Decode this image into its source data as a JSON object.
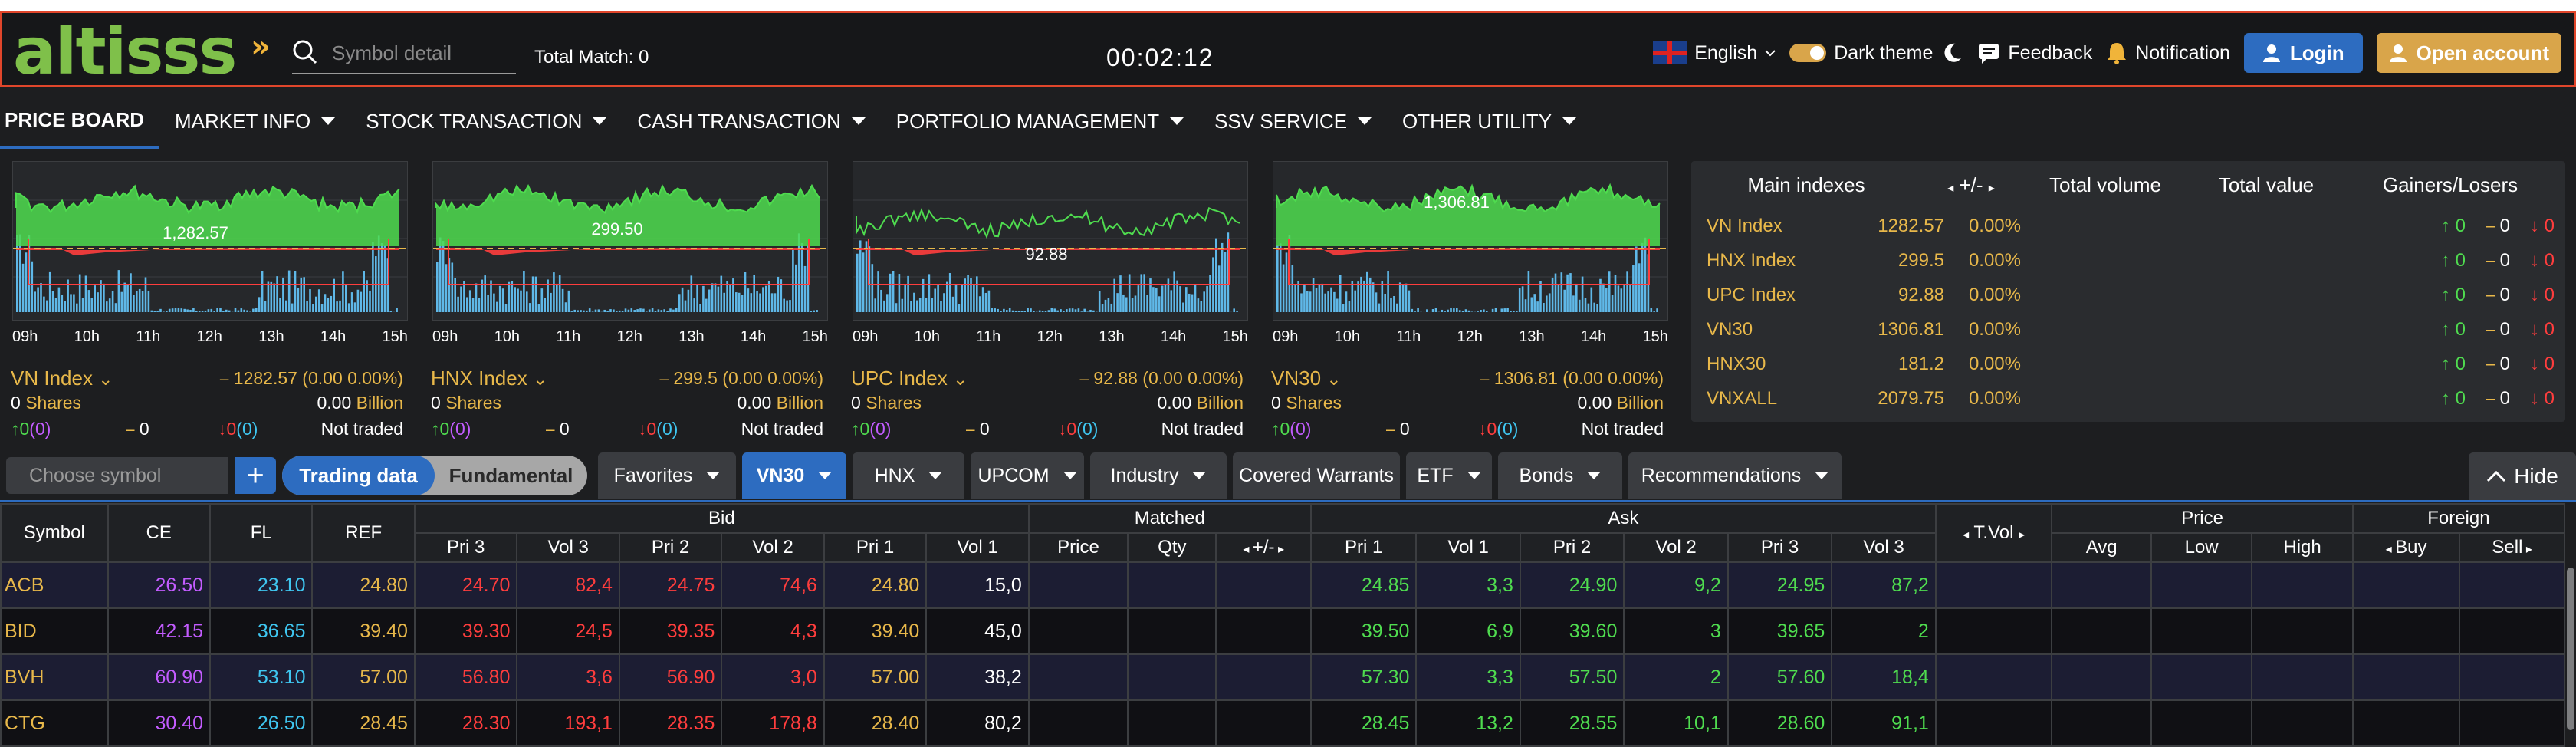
{
  "app": {
    "logo": "altisss",
    "logo_mark": "»"
  },
  "header": {
    "search_placeholder": "Symbol detail",
    "total_match": "Total Match: 0",
    "clock": "00:02:12",
    "language": "English",
    "dark_theme": "Dark theme",
    "feedback": "Feedback",
    "notification": "Notification",
    "login": "Login",
    "open_account": "Open account"
  },
  "nav": [
    "PRICE BOARD",
    "MARKET INFO",
    "STOCK TRANSACTION",
    "CASH TRANSACTION",
    "PORTFOLIO MANAGEMENT",
    "SSV SERVICE",
    "OTHER UTILITY"
  ],
  "hours": [
    "09h",
    "10h",
    "11h",
    "12h",
    "13h",
    "14h",
    "15h"
  ],
  "chart_data": [
    {
      "type": "area",
      "title": "VN Index",
      "label": "1,282.57"
    },
    {
      "type": "area",
      "title": "HNX Index",
      "label": "299.50"
    },
    {
      "type": "area",
      "title": "UPC Index",
      "label": "92.88"
    },
    {
      "type": "area",
      "title": "VN30",
      "label": "1,306.81"
    }
  ],
  "index_cards": [
    {
      "name": "VN Index",
      "value": "1282.57 (0.00 0.00%)",
      "shares": "0",
      "shares_label": "Shares",
      "billion": "0.00",
      "billion_label": "Billion",
      "up": "0",
      "up_c": "(0)",
      "ref": "0",
      "down": "0",
      "down_c": "(0)",
      "status": "Not traded"
    },
    {
      "name": "HNX Index",
      "value": "299.5 (0.00 0.00%)",
      "shares": "0",
      "shares_label": "Shares",
      "billion": "0.00",
      "billion_label": "Billion",
      "up": "0",
      "up_c": "(0)",
      "ref": "0",
      "down": "0",
      "down_c": "(0)",
      "status": "Not traded"
    },
    {
      "name": "UPC Index",
      "value": "92.88 (0.00 0.00%)",
      "shares": "0",
      "shares_label": "Shares",
      "billion": "0.00",
      "billion_label": "Billion",
      "up": "0",
      "up_c": "(0)",
      "ref": "0",
      "down": "0",
      "down_c": "(0)",
      "status": "Not traded"
    },
    {
      "name": "VN30",
      "value": "1306.81 (0.00 0.00%)",
      "shares": "0",
      "shares_label": "Shares",
      "billion": "0.00",
      "billion_label": "Billion",
      "up": "0",
      "up_c": "(0)",
      "ref": "0",
      "down": "0",
      "down_c": "(0)",
      "status": "Not traded"
    }
  ],
  "main_indexes": {
    "headers": [
      "Main indexes",
      "+/-",
      "Total volume",
      "Total value",
      "Gainers/Losers"
    ],
    "rows": [
      {
        "name": "VN Index",
        "value": "1282.57",
        "pct": "0.00%",
        "up": "0",
        "ref": "0",
        "down": "0"
      },
      {
        "name": "HNX Index",
        "value": "299.5",
        "pct": "0.00%",
        "up": "0",
        "ref": "0",
        "down": "0"
      },
      {
        "name": "UPC Index",
        "value": "92.88",
        "pct": "0.00%",
        "up": "0",
        "ref": "0",
        "down": "0"
      },
      {
        "name": "VN30",
        "value": "1306.81",
        "pct": "0.00%",
        "up": "0",
        "ref": "0",
        "down": "0"
      },
      {
        "name": "HNX30",
        "value": "181.2",
        "pct": "0.00%",
        "up": "0",
        "ref": "0",
        "down": "0"
      },
      {
        "name": "VNXALL",
        "value": "2079.75",
        "pct": "0.00%",
        "up": "0",
        "ref": "0",
        "down": "0"
      }
    ]
  },
  "toolbar": {
    "choose_placeholder": "Choose symbol",
    "plus": "+",
    "trading_data": "Trading data",
    "fundamental": "Fundamental",
    "tabs": [
      "Favorites",
      "VN30",
      "HNX",
      "UPCOM",
      "Industry",
      "Covered Warrants",
      "ETF",
      "Bonds",
      "Recommendations"
    ],
    "hide": "Hide"
  },
  "table": {
    "group_headers": {
      "symbol": "Symbol",
      "ce": "CE",
      "fl": "FL",
      "ref": "REF",
      "bid": "Bid",
      "matched": "Matched",
      "ask": "Ask",
      "tvol": "T.Vol",
      "price": "Price",
      "foreign": "Foreign"
    },
    "sub_headers": {
      "bid": [
        "Pri 3",
        "Vol 3",
        "Pri 2",
        "Vol 2",
        "Pri 1",
        "Vol 1"
      ],
      "matched": [
        "Price",
        "Qty",
        "+/-"
      ],
      "ask": [
        "Pri 1",
        "Vol 1",
        "Pri 2",
        "Vol 2",
        "Pri 3",
        "Vol 3"
      ],
      "price": [
        "Avg",
        "Low",
        "High"
      ],
      "foreign": [
        "Buy",
        "Sell"
      ]
    },
    "rows": [
      {
        "sym": "ACB",
        "ce": "26.50",
        "fl": "23.10",
        "ref": "24.80",
        "bid": [
          "24.70",
          "82,4",
          "24.75",
          "74,6",
          "24.80",
          "15,0"
        ],
        "ask": [
          "24.85",
          "3,3",
          "24.90",
          "9,2",
          "24.95",
          "87,2"
        ]
      },
      {
        "sym": "BID",
        "ce": "42.15",
        "fl": "36.65",
        "ref": "39.40",
        "bid": [
          "39.30",
          "24,5",
          "39.35",
          "4,3",
          "39.40",
          "45,0"
        ],
        "ask": [
          "39.50",
          "6,9",
          "39.60",
          "3",
          "39.65",
          "2"
        ]
      },
      {
        "sym": "BVH",
        "ce": "60.90",
        "fl": "53.10",
        "ref": "57.00",
        "bid": [
          "56.80",
          "3,6",
          "56.90",
          "3,0",
          "57.00",
          "38,2"
        ],
        "ask": [
          "57.30",
          "3,3",
          "57.50",
          "2",
          "57.60",
          "18,4"
        ]
      },
      {
        "sym": "CTG",
        "ce": "30.40",
        "fl": "26.50",
        "ref": "28.45",
        "bid": [
          "28.30",
          "193,1",
          "28.35",
          "178,8",
          "28.40",
          "80,2"
        ],
        "ask": [
          "28.45",
          "13,2",
          "28.55",
          "10,1",
          "28.60",
          "91,1"
        ]
      }
    ]
  },
  "colors": {
    "up": "#4fdc4f",
    "down": "#ff3d3d",
    "ref": "#e8b84a",
    "ceil": "#c35cff",
    "floor": "#3fc6f0",
    "accent": "#2d6cc0"
  }
}
